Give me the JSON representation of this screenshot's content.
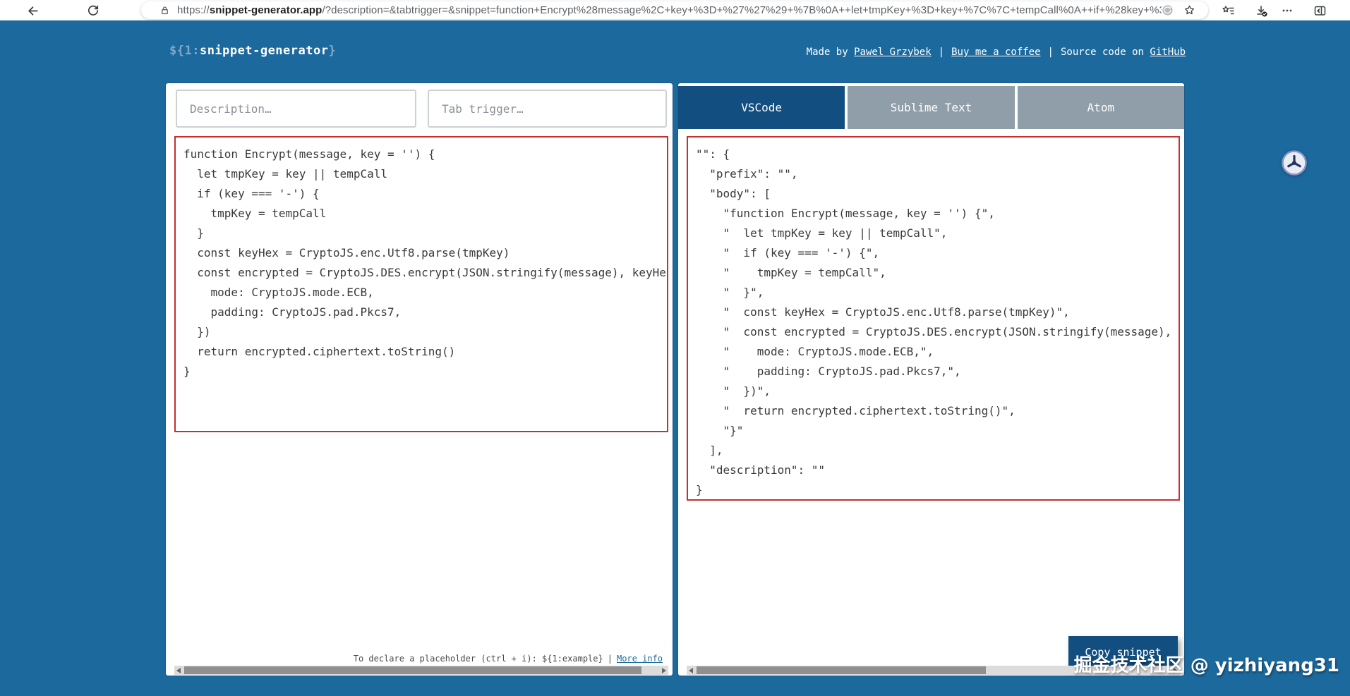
{
  "browser": {
    "url_scheme": "https://",
    "url_domain": "snippet-generator.app",
    "url_path": "/?description=&tabtrigger=&snippet=function+Encrypt%28message%2C+key+%3D+%27%27%29+%7B%0A++let+tmpKey+%3D+key+%7C%7C+tempCall%0A++if+%28key+%3D%3D%3D+%27-%27%29+%7..."
  },
  "icons": {
    "back": "left-arrow",
    "refresh": "circular-arrow",
    "lock": "padlock",
    "extension": "gray-swirl-circle",
    "favorite_star": "star-outline",
    "favorites_bar": "star-with-lines",
    "download": "down-arrow-with-check",
    "more": "three-dots",
    "sidebar": "split-panel",
    "floating_widget": "tri-spoke-circle"
  },
  "header": {
    "title_prefix": "${1:",
    "title_name": "snippet-generator",
    "title_suffix": "}",
    "made_by": "Made by ",
    "author_link": "Pawel Grzybek",
    "sep": "|",
    "coffee_link": "Buy me a coffee",
    "source_text": "Source code on ",
    "github_link": "GitHub"
  },
  "left_panel": {
    "description_placeholder": "Description…",
    "description_value": "",
    "tabtrigger_placeholder": "Tab trigger…",
    "tabtrigger_value": "",
    "code_lines": [
      "function Encrypt(message, key = '') {",
      "  let tmpKey = key || tempCall",
      "  if (key === '-') {",
      "    tmpKey = tempCall",
      "  }",
      "  const keyHex = CryptoJS.enc.Utf8.parse(tmpKey)",
      "  const encrypted = CryptoJS.DES.encrypt(JSON.stringify(message), keyHex",
      "    mode: CryptoJS.mode.ECB,",
      "    padding: CryptoJS.pad.Pkcs7,",
      "  })",
      "  return encrypted.ciphertext.toString()",
      "}"
    ],
    "footer_hint": "To declare a placeholder (ctrl + i): ${1:example}",
    "footer_sep": "|",
    "footer_link": "More info"
  },
  "right_panel": {
    "tabs": [
      {
        "label": "VSCode",
        "active": true
      },
      {
        "label": "Sublime Text",
        "active": false
      },
      {
        "label": "Atom",
        "active": false
      }
    ],
    "output_lines": [
      "\"\": {",
      "  \"prefix\": \"\",",
      "  \"body\": [",
      "    \"function Encrypt(message, key = '') {\",",
      "    \"  let tmpKey = key || tempCall\",",
      "    \"  if (key === '-') {\",",
      "    \"    tmpKey = tempCall\",",
      "    \"  }\",",
      "    \"  const keyHex = CryptoJS.enc.Utf8.parse(tmpKey)\",",
      "    \"  const encrypted = CryptoJS.DES.encrypt(JSON.stringify(message), keyHex",
      "    \"    mode: CryptoJS.mode.ECB,\",",
      "    \"    padding: CryptoJS.pad.Pkcs7,\",",
      "    \"  })\",",
      "    \"  return encrypted.ciphertext.toString()\",",
      "    \"}\"",
      "  ],",
      "  \"description\": \"\"",
      "}"
    ],
    "copy_button": "Copy snippet"
  },
  "watermark": "掘金技术社区 @ yizhiyang31",
  "colors": {
    "page_bg": "#1c699e",
    "accent_dark": "#124f80",
    "tab_inactive": "#8f9ea8",
    "highlight_border": "#c53030",
    "link_blue": "#1d6a9e"
  }
}
